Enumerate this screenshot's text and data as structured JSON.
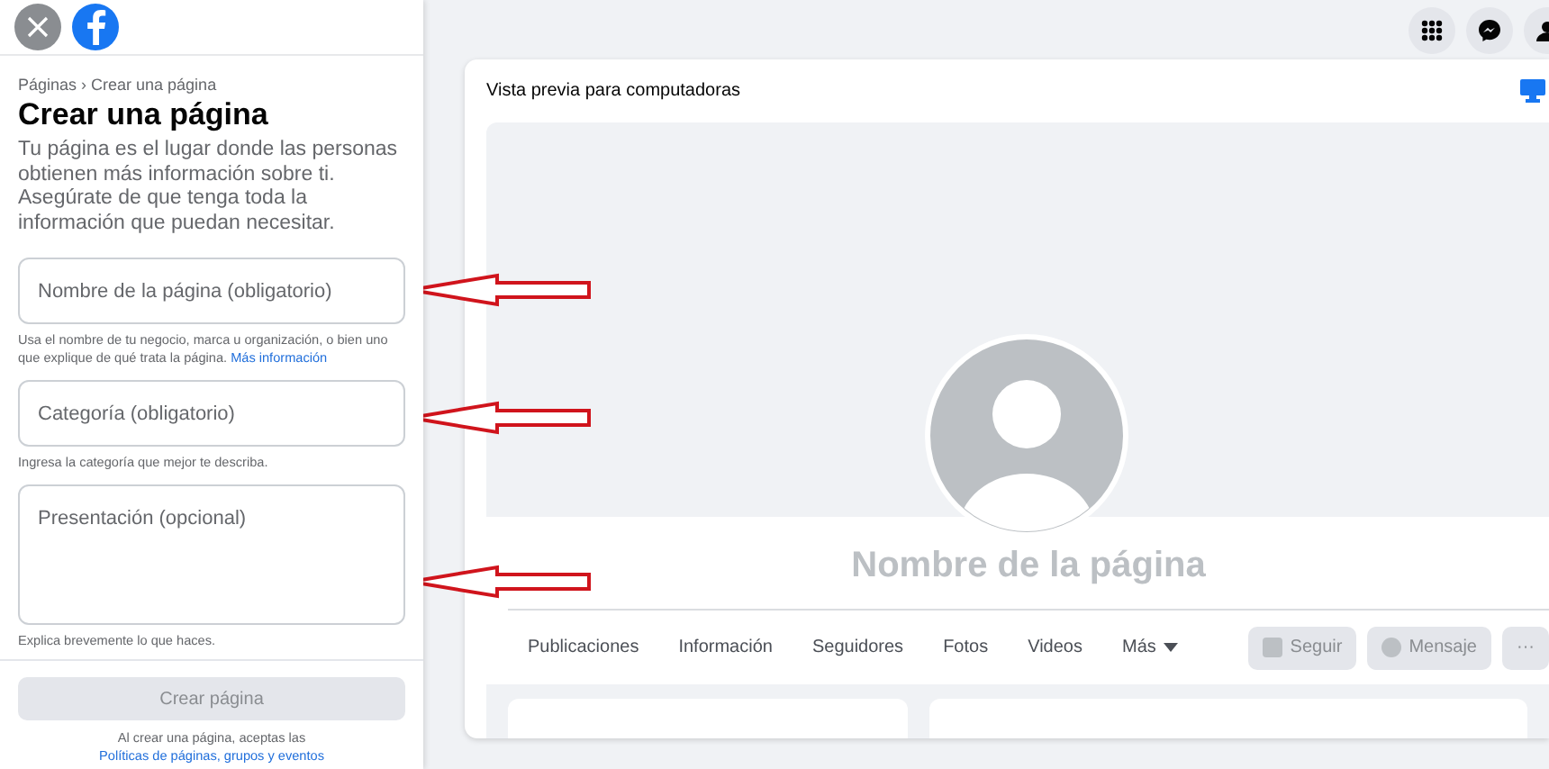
{
  "sidebar": {
    "breadcrumb": "Páginas › Crear una página",
    "title": "Crear una página",
    "description": "Tu página es el lugar donde las personas obtienen más información sobre ti. Asegúrate de que tenga toda la información que puedan necesitar.",
    "fields": [
      {
        "kind": "input",
        "placeholder": "Nombre de la página (obligatorio)",
        "help": "Usa el nombre de tu negocio, marca u organización, o bien uno que explique de qué trata la página.",
        "link": "Más información"
      },
      {
        "kind": "input",
        "placeholder": "Categoría (obligatorio)",
        "help": "Ingresa la categoría que mejor te describa."
      },
      {
        "kind": "textarea",
        "placeholder": "Presentación (opcional)",
        "help": "Explica brevemente lo que haces."
      }
    ],
    "submit": {
      "label": "Crear página",
      "disabled": true
    },
    "terms": {
      "text": "Al crear una página, aceptas las",
      "link": "Políticas de páginas, grupos y eventos"
    }
  },
  "preview": {
    "label": "Vista previa para computadoras",
    "page_name": "Nombre de la página",
    "tabs": [
      {
        "label": "Publicaciones"
      },
      {
        "label": "Información"
      },
      {
        "label": "Seguidores"
      },
      {
        "label": "Fotos"
      },
      {
        "label": "Videos"
      },
      {
        "label": "Más",
        "dropdown": true
      }
    ],
    "actions": [
      {
        "kind": "follow",
        "label": "Seguir",
        "disabled": true
      },
      {
        "kind": "message",
        "label": "Mensaje",
        "disabled": true
      },
      {
        "kind": "more",
        "label": "···",
        "disabled": true
      }
    ]
  }
}
